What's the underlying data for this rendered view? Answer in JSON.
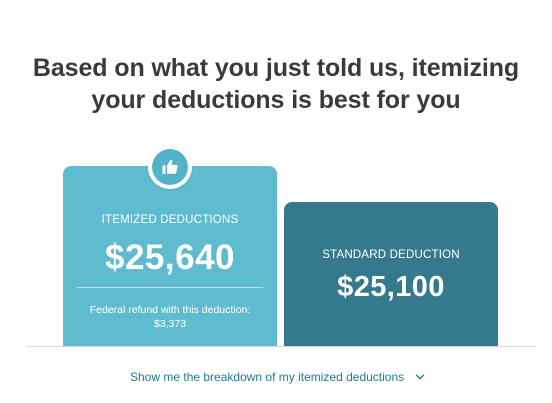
{
  "headline": {
    "line1": "Based on what you just told us, itemizing",
    "line2": "your deductions is best for you"
  },
  "itemized_card": {
    "label": "ITEMIZED DEDUCTIONS",
    "amount": "$25,640",
    "refund_label": "Federal refund with this deduction:",
    "refund_amount": "$3,373",
    "badge_icon": "thumbs-up-icon",
    "color": "#5fbccf"
  },
  "standard_card": {
    "label": "STANDARD DEDUCTION",
    "amount": "$25,100",
    "color": "#357a8c"
  },
  "breakdown_link": {
    "label": "Show me the breakdown of my itemized deductions",
    "icon": "chevron-down-icon",
    "color": "#1f7c8e"
  }
}
